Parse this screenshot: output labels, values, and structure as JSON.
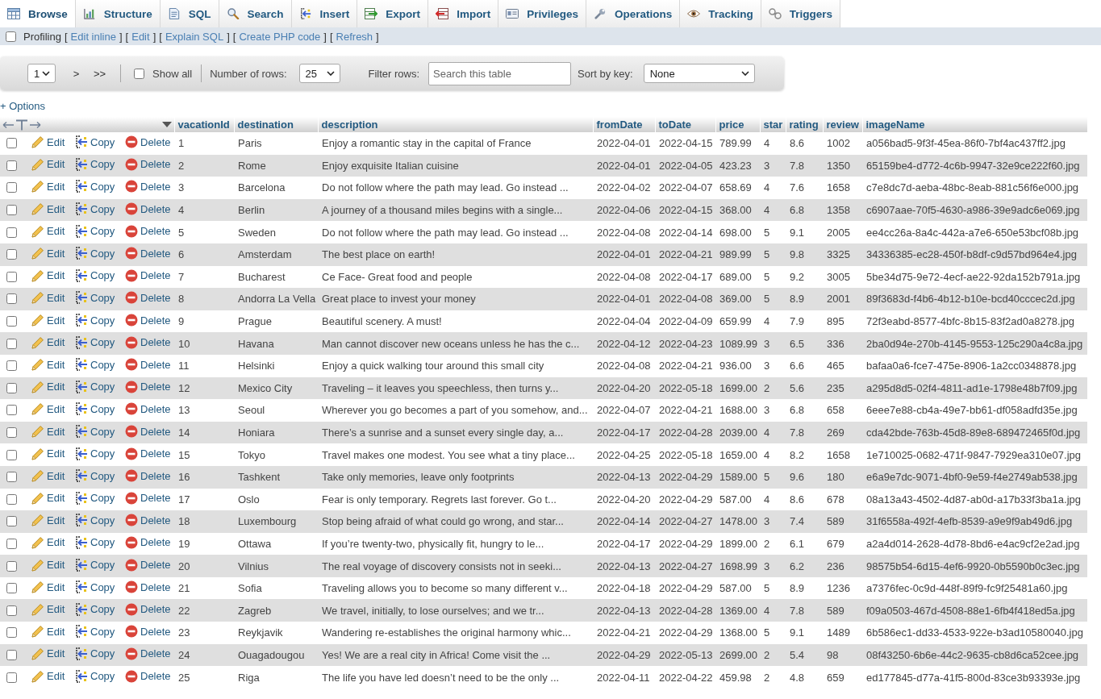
{
  "tabs": [
    {
      "kind": "browse",
      "label": "Browse",
      "selected": true
    },
    {
      "kind": "structure",
      "label": "Structure",
      "selected": false
    },
    {
      "kind": "sql",
      "label": "SQL",
      "selected": false
    },
    {
      "kind": "search",
      "label": "Search",
      "selected": false
    },
    {
      "kind": "insert",
      "label": "Insert",
      "selected": false
    },
    {
      "kind": "export",
      "label": "Export",
      "selected": false
    },
    {
      "kind": "import",
      "label": "Import",
      "selected": false
    },
    {
      "kind": "privileges",
      "label": "Privileges",
      "selected": false
    },
    {
      "kind": "operations",
      "label": "Operations",
      "selected": false
    },
    {
      "kind": "tracking",
      "label": "Tracking",
      "selected": false
    },
    {
      "kind": "triggers",
      "label": "Triggers",
      "selected": false
    }
  ],
  "profiling": {
    "checked": false,
    "label": "Profiling",
    "links": [
      {
        "open": "[",
        "label": "Edit inline",
        "close": "]"
      },
      {
        "open": "[",
        "label": "Edit",
        "close": "]"
      },
      {
        "open": "[",
        "label": "Explain SQL",
        "close": "]"
      },
      {
        "open": "[",
        "label": "Create PHP code",
        "close": "]"
      },
      {
        "open": "[",
        "label": "Refresh",
        "close": "]"
      }
    ]
  },
  "navigation": {
    "page": "1",
    "next_button": ">",
    "last_button": ">>",
    "show_all": {
      "label": "Show all",
      "checked": false
    },
    "rows_label": "Number of rows:",
    "rows_per_page": "25",
    "filter_label": "Filter rows:",
    "filter": {
      "placeholder": "Search this table"
    },
    "sort_label": "Sort by key:",
    "sort_key": "None"
  },
  "options_link": "+ Options",
  "table": {
    "columns": [
      "vacationId",
      "destination",
      "description",
      "fromDate",
      "toDate",
      "price",
      "star",
      "rating",
      "review",
      "imageName"
    ],
    "rows": [
      {
        "checked": false,
        "actions": [
          {
            "kind": "edit",
            "label": "Edit"
          },
          {
            "kind": "copy",
            "label": "Copy"
          },
          {
            "kind": "delete",
            "label": "Delete"
          }
        ],
        "cells": [
          "1",
          "Paris",
          "Enjoy a romantic stay in the capital of France",
          "2022-04-01",
          "2022-04-15",
          "789.99",
          "4",
          "8.6",
          "1002",
          "a056bad5-9f3f-45ea-86f0-7bf4ac437ff2.jpg"
        ]
      },
      {
        "checked": false,
        "actions": [
          {
            "kind": "edit",
            "label": "Edit"
          },
          {
            "kind": "copy",
            "label": "Copy"
          },
          {
            "kind": "delete",
            "label": "Delete"
          }
        ],
        "cells": [
          "2",
          "Rome",
          "Enjoy exquisite Italian cuisine",
          "2022-04-01",
          "2022-04-05",
          "423.23",
          "3",
          "7.8",
          "1350",
          "65159be4-d772-4c6b-9947-32e9ce222f60.jpg"
        ]
      },
      {
        "checked": false,
        "actions": [
          {
            "kind": "edit",
            "label": "Edit"
          },
          {
            "kind": "copy",
            "label": "Copy"
          },
          {
            "kind": "delete",
            "label": "Delete"
          }
        ],
        "cells": [
          "3",
          "Barcelona",
          "Do not follow where the path may lead. Go instead ...",
          "2022-04-02",
          "2022-04-07",
          "658.69",
          "4",
          "7.6",
          "1658",
          "c7e8dc7d-aeba-48bc-8eab-881c56f6e000.jpg"
        ]
      },
      {
        "checked": false,
        "actions": [
          {
            "kind": "edit",
            "label": "Edit"
          },
          {
            "kind": "copy",
            "label": "Copy"
          },
          {
            "kind": "delete",
            "label": "Delete"
          }
        ],
        "cells": [
          "4",
          "Berlin",
          "A journey of a thousand miles begins with a single...",
          "2022-04-06",
          "2022-04-15",
          "368.00",
          "4",
          "6.8",
          "1358",
          "c6907aae-70f5-4630-a986-39e9adc6e069.jpg"
        ]
      },
      {
        "checked": false,
        "actions": [
          {
            "kind": "edit",
            "label": "Edit"
          },
          {
            "kind": "copy",
            "label": "Copy"
          },
          {
            "kind": "delete",
            "label": "Delete"
          }
        ],
        "cells": [
          "5",
          "Sweden",
          "Do not follow where the path may lead. Go instead ...",
          "2022-04-08",
          "2022-04-14",
          "698.00",
          "5",
          "9.1",
          "2005",
          "ee4cc26a-8a4c-442a-a7e6-650e53bcf08b.jpg"
        ]
      },
      {
        "checked": false,
        "actions": [
          {
            "kind": "edit",
            "label": "Edit"
          },
          {
            "kind": "copy",
            "label": "Copy"
          },
          {
            "kind": "delete",
            "label": "Delete"
          }
        ],
        "cells": [
          "6",
          "Amsterdam",
          "The best place on earth!",
          "2022-04-01",
          "2022-04-21",
          "989.99",
          "5",
          "9.8",
          "3325",
          "34336385-ec28-450f-b8df-c9d57bd964e4.jpg"
        ]
      },
      {
        "checked": false,
        "actions": [
          {
            "kind": "edit",
            "label": "Edit"
          },
          {
            "kind": "copy",
            "label": "Copy"
          },
          {
            "kind": "delete",
            "label": "Delete"
          }
        ],
        "cells": [
          "7",
          "Bucharest",
          "Ce Face- Great food and people",
          "2022-04-08",
          "2022-04-17",
          "689.00",
          "5",
          "9.2",
          "3005",
          "5be34d75-9e72-4ecf-ae22-92da152b791a.jpg"
        ]
      },
      {
        "checked": false,
        "actions": [
          {
            "kind": "edit",
            "label": "Edit"
          },
          {
            "kind": "copy",
            "label": "Copy"
          },
          {
            "kind": "delete",
            "label": "Delete"
          }
        ],
        "cells": [
          "8",
          "Andorra La Vella",
          "Great place to invest your money",
          "2022-04-01",
          "2022-04-08",
          "369.00",
          "5",
          "8.9",
          "2001",
          "89f3683d-f4b6-4b12-b10e-bcd40cccec2d.jpg"
        ]
      },
      {
        "checked": false,
        "actions": [
          {
            "kind": "edit",
            "label": "Edit"
          },
          {
            "kind": "copy",
            "label": "Copy"
          },
          {
            "kind": "delete",
            "label": "Delete"
          }
        ],
        "cells": [
          "9",
          "Prague",
          "Beautiful scenery. A must!",
          "2022-04-04",
          "2022-04-09",
          "659.99",
          "4",
          "7.9",
          "895",
          "72f3eabd-8577-4bfc-8b15-83f2ad0a8278.jpg"
        ]
      },
      {
        "checked": false,
        "actions": [
          {
            "kind": "edit",
            "label": "Edit"
          },
          {
            "kind": "copy",
            "label": "Copy"
          },
          {
            "kind": "delete",
            "label": "Delete"
          }
        ],
        "cells": [
          "10",
          "Havana",
          "Man cannot discover new oceans unless he has the c...",
          "2022-04-12",
          "2022-04-23",
          "1089.99",
          "3",
          "6.5",
          "336",
          "2ba0d94e-270b-4145-9553-125c290a4c8a.jpg"
        ]
      },
      {
        "checked": false,
        "actions": [
          {
            "kind": "edit",
            "label": "Edit"
          },
          {
            "kind": "copy",
            "label": "Copy"
          },
          {
            "kind": "delete",
            "label": "Delete"
          }
        ],
        "cells": [
          "11",
          "Helsinki",
          "Enjoy a quick walking tour around this small city",
          "2022-04-08",
          "2022-04-21",
          "936.00",
          "3",
          "6.6",
          "465",
          "bafaa0a6-fce7-475e-8906-1a2cc0348878.jpg"
        ]
      },
      {
        "checked": false,
        "actions": [
          {
            "kind": "edit",
            "label": "Edit"
          },
          {
            "kind": "copy",
            "label": "Copy"
          },
          {
            "kind": "delete",
            "label": "Delete"
          }
        ],
        "cells": [
          "12",
          "Mexico City",
          "Traveling – it leaves you speechless, then turns y...",
          "2022-04-20",
          "2022-05-18",
          "1699.00",
          "2",
          "5.6",
          "235",
          "a295d8d5-02f4-4811-ad1e-1798e48b7f09.jpg"
        ]
      },
      {
        "checked": false,
        "actions": [
          {
            "kind": "edit",
            "label": "Edit"
          },
          {
            "kind": "copy",
            "label": "Copy"
          },
          {
            "kind": "delete",
            "label": "Delete"
          }
        ],
        "cells": [
          "13",
          "Seoul",
          "Wherever you go becomes a part of you somehow, and...",
          "2022-04-07",
          "2022-04-21",
          "1688.00",
          "3",
          "6.8",
          "658",
          "6eee7e88-cb4a-49e7-bb61-df058adfd35e.jpg"
        ]
      },
      {
        "checked": false,
        "actions": [
          {
            "kind": "edit",
            "label": "Edit"
          },
          {
            "kind": "copy",
            "label": "Copy"
          },
          {
            "kind": "delete",
            "label": "Delete"
          }
        ],
        "cells": [
          "14",
          "Honiara",
          "There’s a sunrise and a sunset every single day, a...",
          "2022-04-17",
          "2022-04-28",
          "2039.00",
          "4",
          "7.8",
          "269",
          "cda42bde-763b-45d8-89e8-689472465f0d.jpg"
        ]
      },
      {
        "checked": false,
        "actions": [
          {
            "kind": "edit",
            "label": "Edit"
          },
          {
            "kind": "copy",
            "label": "Copy"
          },
          {
            "kind": "delete",
            "label": "Delete"
          }
        ],
        "cells": [
          "15",
          "Tokyo",
          "Travel makes one modest. You see what a tiny place...",
          "2022-04-25",
          "2022-05-18",
          "1659.00",
          "4",
          "8.2",
          "1658",
          "1e710025-0682-471f-9847-7929ea310e07.jpg"
        ]
      },
      {
        "checked": false,
        "actions": [
          {
            "kind": "edit",
            "label": "Edit"
          },
          {
            "kind": "copy",
            "label": "Copy"
          },
          {
            "kind": "delete",
            "label": "Delete"
          }
        ],
        "cells": [
          "16",
          "Tashkent",
          "Take only memories, leave only footprints",
          "2022-04-13",
          "2022-04-29",
          "1589.00",
          "5",
          "9.6",
          "180",
          "e6a9e7dc-9071-4bf0-9e59-f4e2749ab538.jpg"
        ]
      },
      {
        "checked": false,
        "actions": [
          {
            "kind": "edit",
            "label": "Edit"
          },
          {
            "kind": "copy",
            "label": "Copy"
          },
          {
            "kind": "delete",
            "label": "Delete"
          }
        ],
        "cells": [
          "17",
          "Oslo",
          "Fear is only temporary. Regrets last forever. Go t...",
          "2022-04-20",
          "2022-04-29",
          "587.00",
          "4",
          "8.6",
          "678",
          "08a13a43-4502-4d87-ab0d-a17b33f3ba1a.jpg"
        ]
      },
      {
        "checked": false,
        "actions": [
          {
            "kind": "edit",
            "label": "Edit"
          },
          {
            "kind": "copy",
            "label": "Copy"
          },
          {
            "kind": "delete",
            "label": "Delete"
          }
        ],
        "cells": [
          "18",
          "Luxembourg",
          "Stop being afraid of what could go wrong, and star...",
          "2022-04-14",
          "2022-04-27",
          "1478.00",
          "3",
          "7.4",
          "589",
          "31f6558a-492f-4efb-8539-a9e9f9ab49d6.jpg"
        ]
      },
      {
        "checked": false,
        "actions": [
          {
            "kind": "edit",
            "label": "Edit"
          },
          {
            "kind": "copy",
            "label": "Copy"
          },
          {
            "kind": "delete",
            "label": "Delete"
          }
        ],
        "cells": [
          "19",
          "Ottawa",
          "If you’re twenty-two, physically fit, hungry to le...",
          "2022-04-17",
          "2022-04-29",
          "1899.00",
          "2",
          "6.1",
          "679",
          "a2a4d014-2628-4d78-8bd6-e4ac9cf2e2ad.jpg"
        ]
      },
      {
        "checked": false,
        "actions": [
          {
            "kind": "edit",
            "label": "Edit"
          },
          {
            "kind": "copy",
            "label": "Copy"
          },
          {
            "kind": "delete",
            "label": "Delete"
          }
        ],
        "cells": [
          "20",
          "Vilnius",
          "The real voyage of discovery consists not in seeki...",
          "2022-04-13",
          "2022-04-27",
          "1698.99",
          "3",
          "6.2",
          "236",
          "98575b54-6d15-4ef6-9920-0b5590b0c3ec.jpg"
        ]
      },
      {
        "checked": false,
        "actions": [
          {
            "kind": "edit",
            "label": "Edit"
          },
          {
            "kind": "copy",
            "label": "Copy"
          },
          {
            "kind": "delete",
            "label": "Delete"
          }
        ],
        "cells": [
          "21",
          "Sofia",
          "Traveling allows you to become so many different v...",
          "2022-04-18",
          "2022-04-29",
          "587.00",
          "5",
          "8.9",
          "1236",
          "a7376fec-0c9d-448f-89f9-fc9f25481a60.jpg"
        ]
      },
      {
        "checked": false,
        "actions": [
          {
            "kind": "edit",
            "label": "Edit"
          },
          {
            "kind": "copy",
            "label": "Copy"
          },
          {
            "kind": "delete",
            "label": "Delete"
          }
        ],
        "cells": [
          "22",
          "Zagreb",
          "We travel, initially, to lose ourselves; and we tr...",
          "2022-04-13",
          "2022-04-28",
          "1369.00",
          "4",
          "7.8",
          "589",
          "f09a0503-467d-4508-88e1-6fb4f418ed5a.jpg"
        ]
      },
      {
        "checked": false,
        "actions": [
          {
            "kind": "edit",
            "label": "Edit"
          },
          {
            "kind": "copy",
            "label": "Copy"
          },
          {
            "kind": "delete",
            "label": "Delete"
          }
        ],
        "cells": [
          "23",
          "Reykjavik",
          "Wandering re-establishes the original harmony whic...",
          "2022-04-21",
          "2022-04-29",
          "1368.00",
          "5",
          "9.1",
          "1489",
          "6b586ec1-dd33-4533-922e-b3ad10580040.jpg"
        ]
      },
      {
        "checked": false,
        "actions": [
          {
            "kind": "edit",
            "label": "Edit"
          },
          {
            "kind": "copy",
            "label": "Copy"
          },
          {
            "kind": "delete",
            "label": "Delete"
          }
        ],
        "cells": [
          "24",
          "Ouagadougou",
          "Yes! We are a real city in Africa! Come visit the ...",
          "2022-04-29",
          "2022-05-13",
          "2699.00",
          "2",
          "5.4",
          "98",
          "08f43250-6b6e-44c2-9635-cb8d6ca52cee.jpg"
        ]
      },
      {
        "checked": false,
        "actions": [
          {
            "kind": "edit",
            "label": "Edit"
          },
          {
            "kind": "copy",
            "label": "Copy"
          },
          {
            "kind": "delete",
            "label": "Delete"
          }
        ],
        "cells": [
          "25",
          "Riga",
          "The life you have led doesn’t need to be the only ...",
          "2022-04-11",
          "2022-04-22",
          "459.98",
          "2",
          "4.8",
          "659",
          "ed177845-d77a-41f5-800d-83ce3b93393e.jpg"
        ]
      }
    ]
  }
}
